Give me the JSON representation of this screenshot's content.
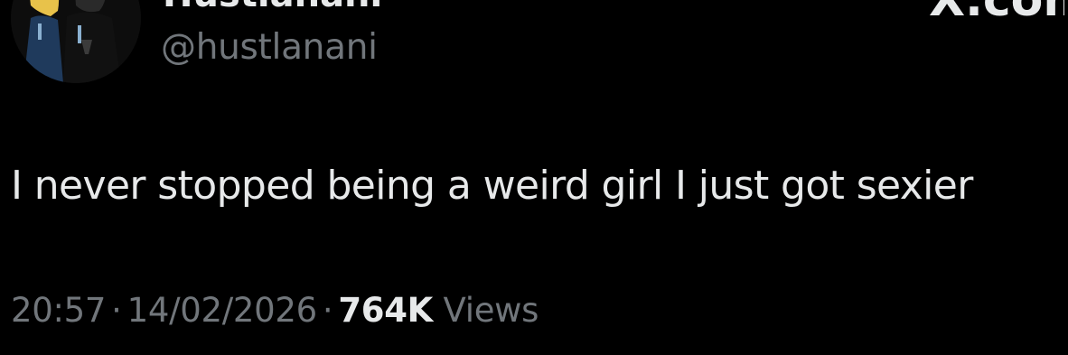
{
  "author": {
    "display_name": "Hustlanani",
    "handle": "@hustlanani",
    "avatar_icon": "cartoon-avatar-icon"
  },
  "brand": {
    "logo_text": "X.com"
  },
  "tweet": {
    "text": "I never stopped being a weird girl I just got sexier"
  },
  "meta": {
    "time": "20:57",
    "separator": "·",
    "date": "14/02/2026",
    "views_count": "764K",
    "views_label": "Views"
  },
  "colors": {
    "background": "#000000",
    "primary_text": "#e7e9ea",
    "secondary_text": "#71767b"
  }
}
